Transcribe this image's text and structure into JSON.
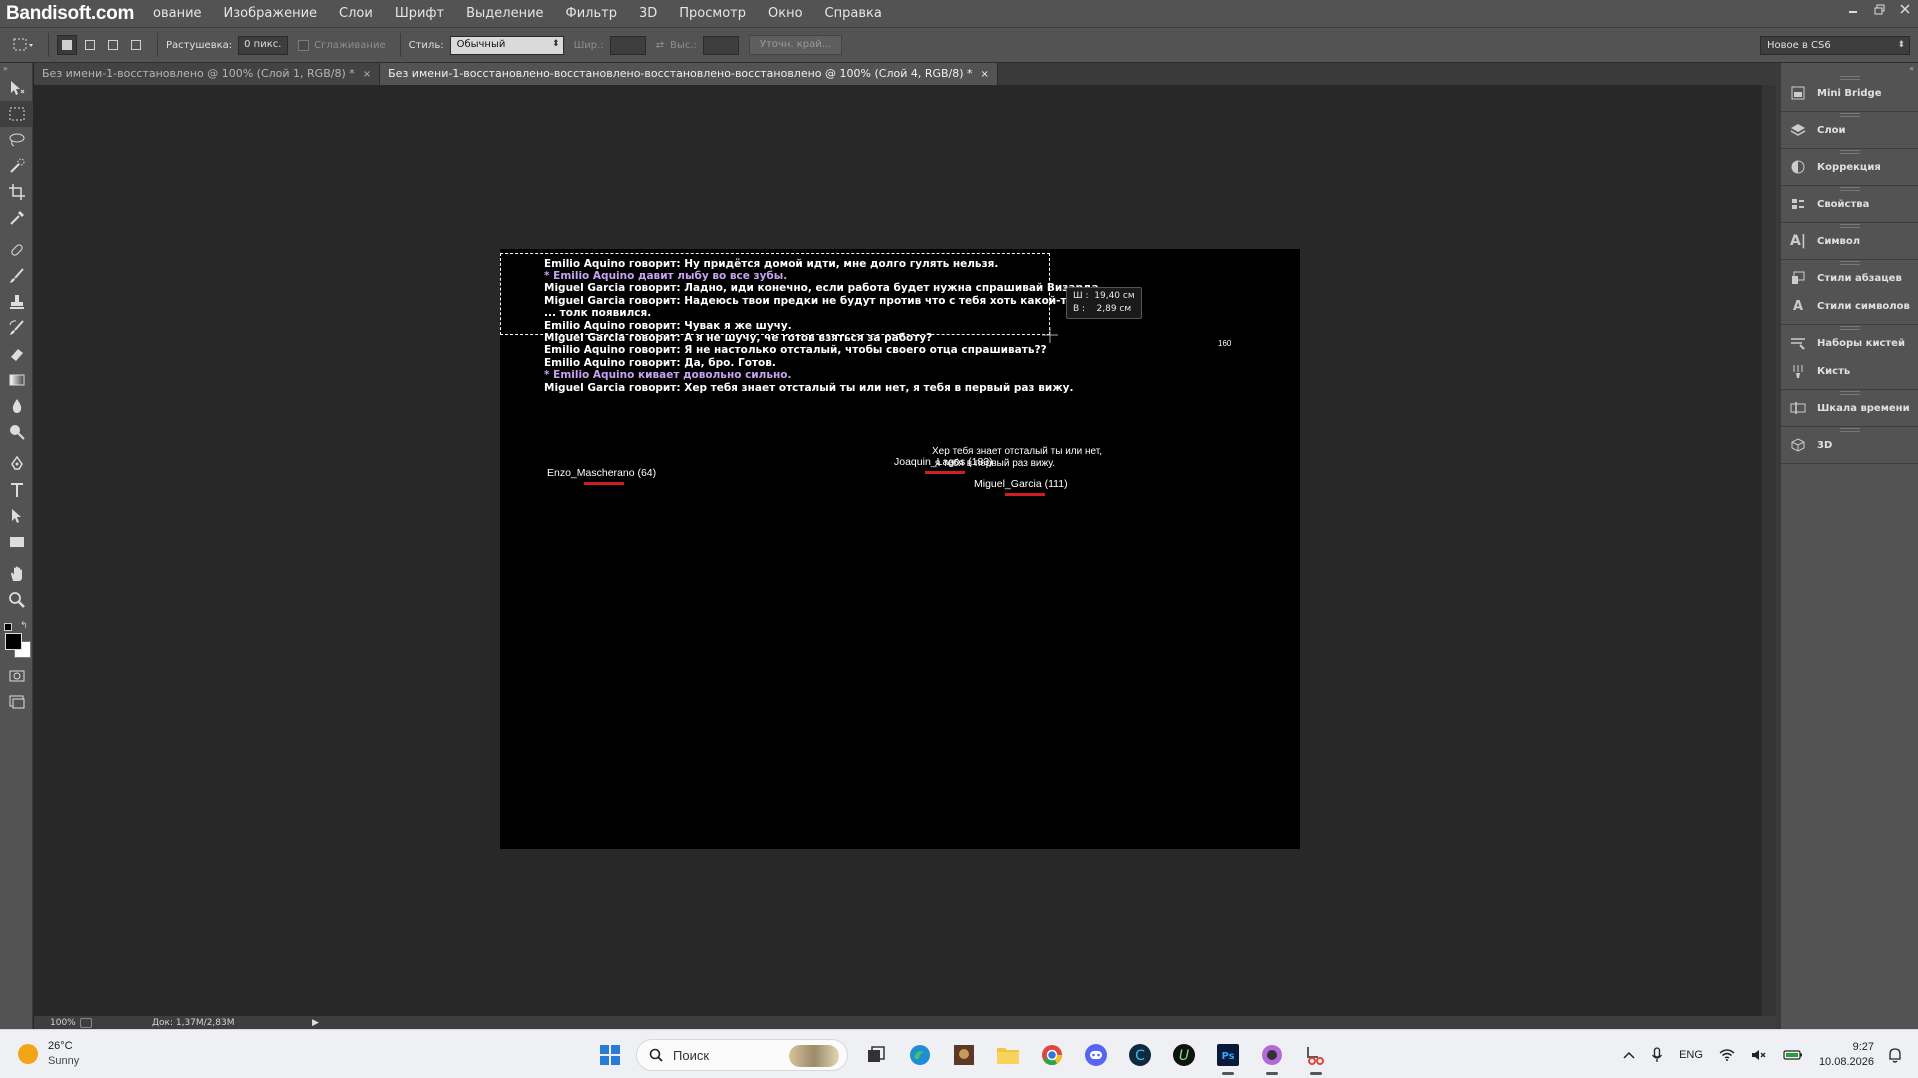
{
  "watermark": "Bandisoft.com",
  "menu": [
    "ование",
    "Изображение",
    "Слои",
    "Шрифт",
    "Выделение",
    "Фильтр",
    "3D",
    "Просмотр",
    "Окно",
    "Справка"
  ],
  "options": {
    "feather_label": "Растушевка:",
    "feather_value": "0 пикс.",
    "antialias_label": "Сглаживание",
    "style_label": "Стиль:",
    "style_value": "Обычный",
    "width_label": "Шир.:",
    "height_label": "Выс.:",
    "refine_button": "Уточн. край...",
    "workspace": "Новое в CS6"
  },
  "tabs": [
    {
      "title": "Без имени-1-восстановлено @ 100% (Слой 1, RGB/8) *",
      "active": false
    },
    {
      "title": "Без имени-1-восстановлено-восстановлено-восстановлено-восстановлено @ 100% (Слой 4, RGB/8) *",
      "active": true
    }
  ],
  "canvas": {
    "chat": [
      {
        "text": "Emilio Aquino говорит: Ну придётся домой идти, мне долго гулять нельзя.",
        "emote": false
      },
      {
        "text": "* Emilio Aquino давит лыбу во все зубы.",
        "emote": true
      },
      {
        "text": "Miguel Garcia говорит: Ладно, иди конечно, если работа будет нужна спрашивай Визарда.",
        "emote": false
      },
      {
        "text": "Miguel Garcia говорит: Надеюсь твои предки не будут против что с тебя хоть какой-то ...",
        "emote": false
      },
      {
        "text": "... толк появился.",
        "emote": false
      },
      {
        "text": "Emilio Aquino говорит: Чувак я же шучу.",
        "emote": false
      },
      {
        "text": "Miguel Garcia говорит: А я не шучу, че готов взяться за работу?",
        "emote": false
      },
      {
        "text": "Emilio Aquino говорит: Я не настолько отсталый, чтобы своего отца спрашивать??",
        "emote": false
      },
      {
        "text": "Emilio Aquino говорит: Да, бро. Готов.",
        "emote": false
      },
      {
        "text": "* Emilio Aquino кивает довольно сильно.",
        "emote": true
      },
      {
        "text": "Miguel Garcia говорит: Хер тебя знает отсталый ты или нет, я тебя в первый раз вижу.",
        "emote": false
      }
    ],
    "selection_info": {
      "w_label": "Ш :",
      "w_value": "19,40 см",
      "h_label": "В :",
      "h_value": "2,89 см"
    },
    "nick_enzo": "Enzo_Mascherano (64)",
    "nick_joaquin": "Joaquin_Lagos (183)",
    "nick_miguel": "Miguel_Garcia (111)",
    "bubble_line1": "Хер тебя знает отсталый ты или нет,",
    "bubble_line2": "я тебя в первый раз вижу.",
    "small_num": "160"
  },
  "status": {
    "zoom": "100%",
    "doc": "Док: 1,37M/2,83M"
  },
  "panels": [
    {
      "items": [
        {
          "label": "Mini Bridge",
          "icon": "mini-bridge-icon"
        }
      ]
    },
    {
      "items": [
        {
          "label": "Слои",
          "icon": "layers-icon"
        }
      ]
    },
    {
      "items": [
        {
          "label": "Коррекция",
          "icon": "adjustments-icon"
        }
      ]
    },
    {
      "items": [
        {
          "label": "Свойства",
          "icon": "properties-icon"
        }
      ]
    },
    {
      "items": [
        {
          "label": "Символ",
          "icon": "character-icon"
        }
      ]
    },
    {
      "items": [
        {
          "label": "Стили абзацев",
          "icon": "paragraph-styles-icon"
        },
        {
          "label": "Стили символов",
          "icon": "character-styles-icon"
        }
      ]
    },
    {
      "items": [
        {
          "label": "Наборы кистей",
          "icon": "brush-presets-icon"
        },
        {
          "label": "Кисть",
          "icon": "brush-icon"
        }
      ]
    },
    {
      "items": [
        {
          "label": "Шкала времени",
          "icon": "timeline-icon"
        }
      ]
    },
    {
      "items": [
        {
          "label": "3D",
          "icon": "3d-icon"
        }
      ]
    }
  ],
  "taskbar": {
    "temp": "26°C",
    "weather": "Sunny",
    "search_placeholder": "Поиск",
    "lang": "ENG",
    "time": "9:27",
    "date": "10.08.2026"
  }
}
